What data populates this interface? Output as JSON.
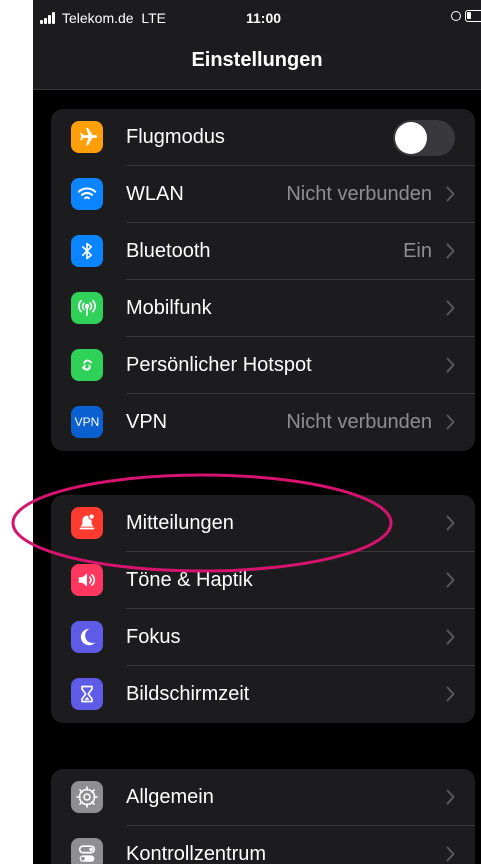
{
  "status_bar": {
    "carrier": "Telekom.de",
    "network": "LTE",
    "time": "11:00"
  },
  "nav": {
    "title": "Einstellungen"
  },
  "groups": [
    {
      "rows": [
        {
          "label": "Flugmodus",
          "icon": "airplane-icon",
          "color": "#ff9f0a",
          "toggle": false
        },
        {
          "label": "WLAN",
          "value": "Nicht verbunden",
          "icon": "wifi-icon",
          "color": "#0a84ff"
        },
        {
          "label": "Bluetooth",
          "value": "Ein",
          "icon": "bluetooth-icon",
          "color": "#0a84ff"
        },
        {
          "label": "Mobilfunk",
          "value": "",
          "icon": "antenna-icon",
          "color": "#30d158"
        },
        {
          "label": "Persönlicher Hotspot",
          "value": "",
          "icon": "hotspot-icon",
          "color": "#30d158"
        },
        {
          "label": "VPN",
          "value": "Nicht verbunden",
          "icon": "vpn-icon",
          "icon_text": "VPN",
          "color": "#0a60d0"
        }
      ]
    },
    {
      "rows": [
        {
          "label": "Mitteilungen",
          "value": "",
          "icon": "notification-bell-icon",
          "color": "#ff3b30"
        },
        {
          "label": "Töne & Haptik",
          "value": "",
          "icon": "speaker-icon",
          "color": "#ff375f"
        },
        {
          "label": "Fokus",
          "value": "",
          "icon": "moon-icon",
          "color": "#5e5ce6"
        },
        {
          "label": "Bildschirmzeit",
          "value": "",
          "icon": "hourglass-icon",
          "color": "#5e5ce6"
        }
      ]
    },
    {
      "rows": [
        {
          "label": "Allgemein",
          "value": "",
          "icon": "gear-icon",
          "color": "#8e8e93"
        },
        {
          "label": "Kontrollzentrum",
          "value": "",
          "icon": "switches-icon",
          "color": "#8e8e93"
        }
      ]
    }
  ],
  "colors": {
    "background": "#000000",
    "cell": "#1c1c1e",
    "secondary_text": "#8d8d93",
    "highlight_ring": "#d6136e"
  }
}
